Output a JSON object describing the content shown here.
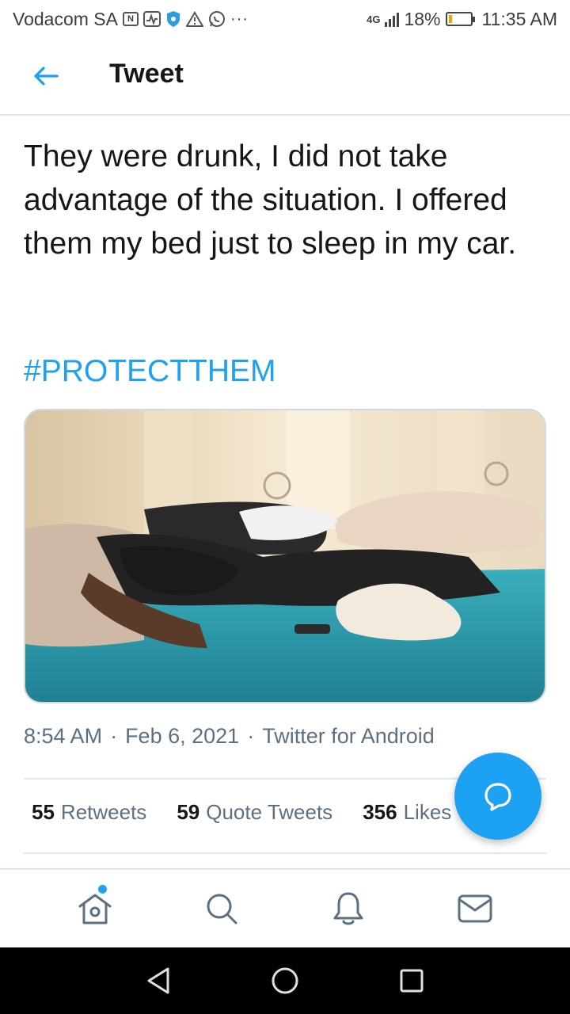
{
  "status_bar": {
    "carrier": "Vodacom SA",
    "network": "4G",
    "battery": "18%",
    "battery_level": 0.18,
    "time": "11:35 AM",
    "more": "···"
  },
  "header": {
    "title": "Tweet"
  },
  "tweet": {
    "text": "They were drunk, I did not take advantage of the situation. I offered them my bed just to sleep in my car.",
    "hashtag": "#PROTECTTHEM",
    "time": "8:54 AM",
    "separator": "·",
    "date": "Feb 6, 2021",
    "source": "Twitter for Android"
  },
  "stats": {
    "retweets_count": "55",
    "retweets_label": "Retweets",
    "quotes_count": "59",
    "quotes_label": "Quote Tweets",
    "likes_count": "356",
    "likes_label": "Likes"
  },
  "colors": {
    "accent": "#1da1f2",
    "text": "#14171a",
    "secondary": "#5b7083",
    "divider": "#e1e8ed"
  },
  "icons": {
    "back": "arrow-left-icon",
    "fab": "reply-bubble-icon",
    "home": "home-icon",
    "search": "search-icon",
    "notifications": "bell-icon",
    "messages": "mail-icon",
    "nav_back": "triangle-back-icon",
    "nav_home": "circle-home-icon",
    "nav_recent": "square-recent-icon"
  }
}
